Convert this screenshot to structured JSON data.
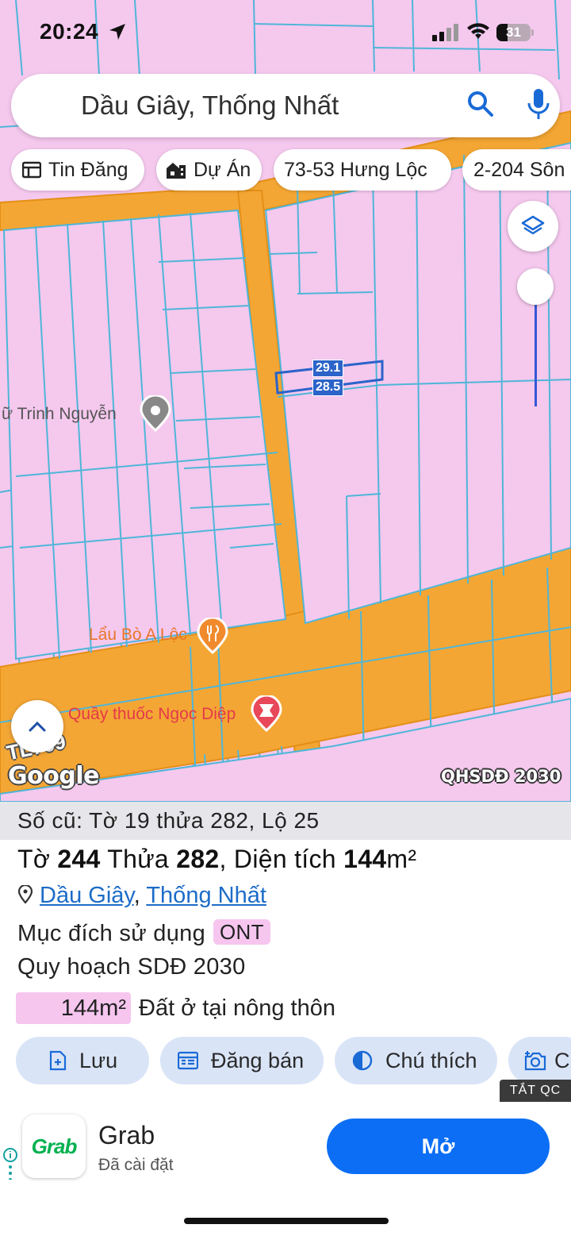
{
  "status_bar": {
    "time": "20:24",
    "battery": "31"
  },
  "search": {
    "query": "Dầu Giây, Thống Nhất"
  },
  "chips": [
    {
      "label": "Tin Đăng",
      "icon": "news-icon"
    },
    {
      "label": "Dự Án",
      "icon": "building-icon"
    },
    {
      "label": "73-53 Hưng Lộc"
    },
    {
      "label": "2-204 Sôn"
    }
  ],
  "map": {
    "parcel_top": "29.1",
    "parcel_bottom": "28.5",
    "poi_1": "ữ Trinh Nguyễn",
    "poi_2": "Lẩu Bò A Lộc",
    "poi_3": "Quầy thuốc Ngọc Diệp",
    "road_tag": "TL769",
    "google": "Google",
    "overlay_label": "QHSDĐ 2030",
    "colors": {
      "land": "#f5c8ee",
      "road": "#f4a634",
      "parcel_line": "#4fb6d8",
      "selection": "#2b63c9"
    }
  },
  "parcel": {
    "old_info": "Số cũ: Tờ 19 thửa 282, Lộ 25",
    "to_label": "Tờ",
    "to_value": "244",
    "thua_label": "Thửa",
    "thua_value": "282",
    "area_label": ", Diện tích",
    "area_value": "144",
    "area_unit": "m²",
    "district": "Dầu Giây",
    "separator": ",",
    "commune": "Thống Nhất",
    "purpose_label": "Mục đích sử dụng",
    "purpose_code": "ONT",
    "plan_label": "Quy hoạch SDĐ 2030",
    "plan_area": "144m²",
    "plan_type": "Đất ở tại nông thôn"
  },
  "actions": [
    {
      "label": "Lưu",
      "icon": "save-icon"
    },
    {
      "label": "Đăng bán",
      "icon": "post-icon"
    },
    {
      "label": "Chú thích",
      "icon": "legend-icon"
    },
    {
      "label": "C",
      "icon": "camera-icon"
    }
  ],
  "ad": {
    "close_label": "TẮT QC",
    "logo_text": "Grab",
    "app_name": "Grab",
    "status": "Đã cài đặt",
    "open_label": "Mở"
  }
}
